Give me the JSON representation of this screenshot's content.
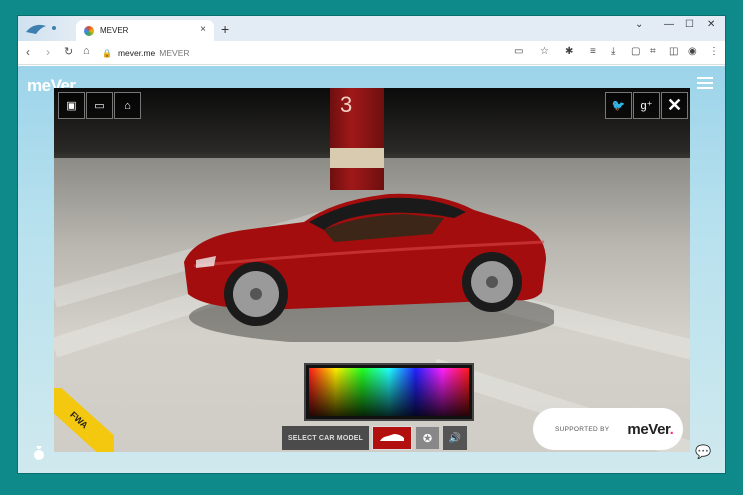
{
  "browser": {
    "tab_title": "MEVER",
    "tab_close": "×",
    "new_tab": "+",
    "url_domain": "mever.me",
    "url_title": "MEVER",
    "window_controls": {
      "minimize": "—",
      "maximize": "☐",
      "close": "✕",
      "dropdown": "⌄"
    }
  },
  "site": {
    "brand_name": "meVer",
    "brand_dot": ".",
    "car_pillar_number": "3",
    "color_picker_label": "",
    "bottom_bar": {
      "select_model_label": "SELECT CAR MODEL",
      "sound_icon": "🔊"
    },
    "supported_label": "SUPPORTED BY",
    "supported_logo": "meVer",
    "supported_logo_dot": ".",
    "badge_text": "FWA"
  },
  "colors": {
    "accent_teal": "#0f8a8a",
    "car_red": "#b20f0f",
    "brand_pink": "#ff4fa0"
  }
}
